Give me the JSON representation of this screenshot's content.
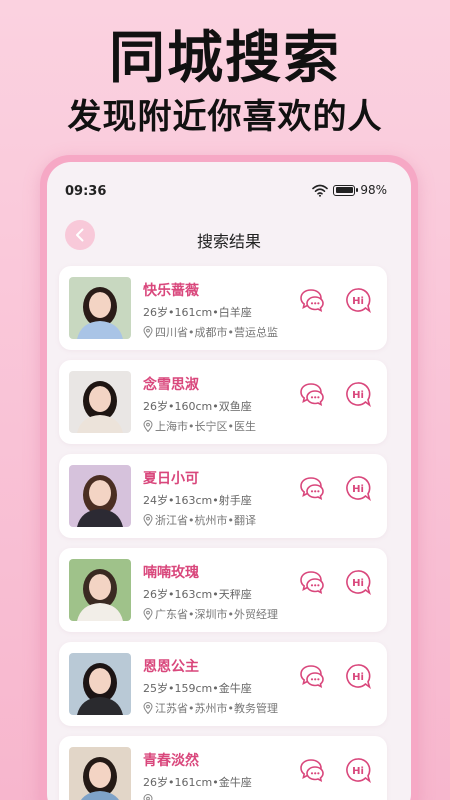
{
  "hero": {
    "title": "同城搜索",
    "subtitle": "发现附近你喜欢的人"
  },
  "status_bar": {
    "time": "09:36",
    "battery": "98%"
  },
  "nav": {
    "title": "搜索结果"
  },
  "colors": {
    "accent": "#d9477c",
    "background_pink": "#f9c2d6",
    "frame_pink": "#f6a8c5"
  },
  "results": [
    {
      "name": "快乐蔷薇",
      "info": "26岁•161cm•白羊座",
      "location": "四川省•成都市•营运总监"
    },
    {
      "name": "念雪思淑",
      "info": "26岁•160cm•双鱼座",
      "location": "上海市•长宁区•医生"
    },
    {
      "name": "夏日小可",
      "info": "24岁•163cm•射手座",
      "location": "浙江省•杭州市•翻译"
    },
    {
      "name": "喃喃玫瑰",
      "info": "26岁•163cm•天秤座",
      "location": "广东省•深圳市•外贸经理"
    },
    {
      "name": "恩恩公主",
      "info": "25岁•159cm•金牛座",
      "location": "江苏省•苏州市•教务管理"
    },
    {
      "name": "青春淡然",
      "info": "26岁•161cm•金牛座",
      "location": ""
    }
  ]
}
